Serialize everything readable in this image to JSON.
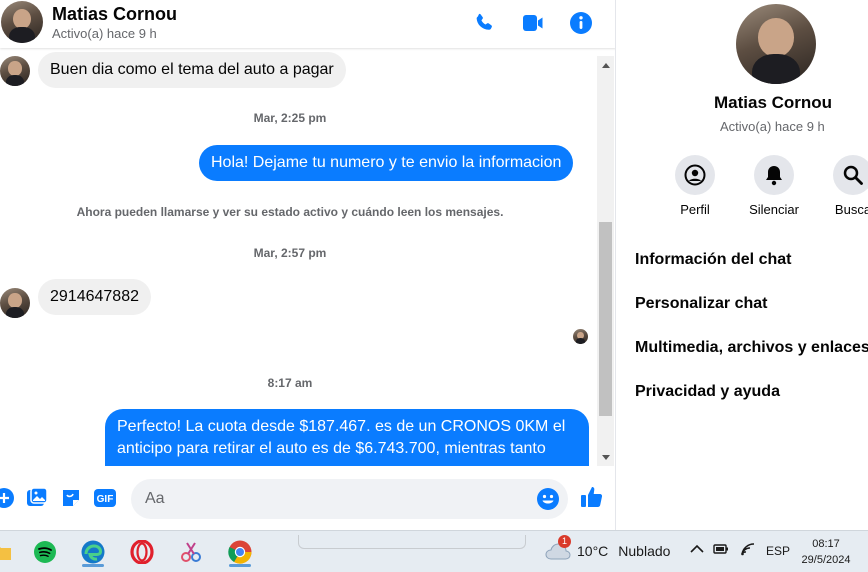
{
  "header": {
    "name": "Matias Cornou",
    "status": "Activo(a) hace 9 h"
  },
  "messages": {
    "msg1": "Buen dia como el tema del auto a pagar",
    "ts1": "Mar, 2:25 pm",
    "msg2": "Hola! Dejame tu numero y te envio la informacion",
    "system": "Ahora pueden llamarse y ver su estado activo y cuándo leen los mensajes.",
    "ts2": "Mar, 2:57 pm",
    "msg3": "2914647882",
    "ts3": "8:17 am",
    "msg4_line1": "Perfecto! La cuota desde $187.467. es de un CRONOS 0KM el",
    "msg4_line2": "anticipo para retirar el auto es de $6.743.700, mientras tanto"
  },
  "composer": {
    "placeholder": "Aa"
  },
  "panel": {
    "name": "Matias Cornou",
    "status": "Activo(a) hace 9 h",
    "actions": [
      {
        "label": "Perfil",
        "icon": "profile-icon"
      },
      {
        "label": "Silenciar",
        "icon": "bell-icon"
      },
      {
        "label": "Busca",
        "icon": "search-icon"
      }
    ],
    "items": [
      {
        "label": "Información del chat"
      },
      {
        "label": "Personalizar chat"
      },
      {
        "label": "Multimedia, archivos y enlaces"
      },
      {
        "label": "Privacidad y ayuda"
      }
    ]
  },
  "taskbar": {
    "weather_badge": "1",
    "weather_temp": "10°C",
    "weather_desc": "Nublado",
    "lang": "ESP",
    "time": "08:17",
    "date": "29/5/2024"
  },
  "colors": {
    "accent": "#0a7cff",
    "incoming_bubble": "#f0f0f0",
    "taskbar": "#e6ecf2"
  }
}
